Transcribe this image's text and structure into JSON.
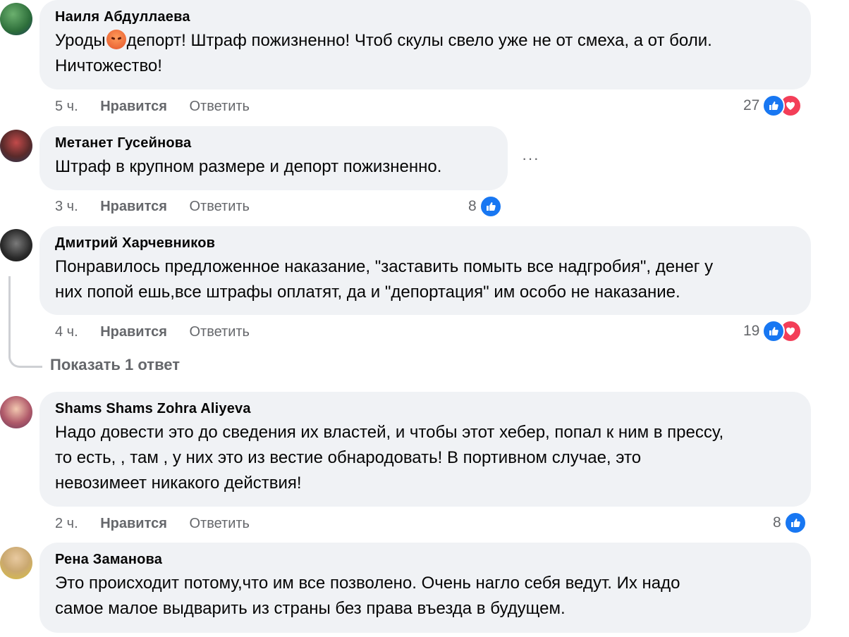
{
  "comments": [
    {
      "author": "Наиля Абдуллаева",
      "text_before_emoji": "Уроды",
      "emoji": "angry-face",
      "text_after_emoji": "депорт! Штраф пожизненно! Чтоб скулы свело уже не от смеха, а от боли.",
      "text_line2": "Ничтожество!",
      "time": "5 ч.",
      "like_label": "Нравится",
      "reply_label": "Ответить",
      "reaction_count": "27",
      "reactions": [
        "like",
        "love"
      ]
    },
    {
      "author": "Метанет Гусейнова",
      "text": "Штраф в крупном размере и депорт пожизненно.",
      "time": "3 ч.",
      "like_label": "Нравится",
      "reply_label": "Ответить",
      "reaction_count": "8",
      "reactions": [
        "like"
      ],
      "more_label": "···"
    },
    {
      "author": "Дмитрий Харчевников",
      "text": "Понравилось предложенное наказание, \"заставить помыть все надгробия\", денег у\nних попой ешь,все штрафы оплатят, да и \"депортация\" им особо не наказание.",
      "time": "4 ч.",
      "like_label": "Нравится",
      "reply_label": "Ответить",
      "reaction_count": "19",
      "reactions": [
        "like",
        "love"
      ],
      "show_replies_label": "Показать 1 ответ"
    },
    {
      "author": "Shams Shams Zohra Aliyeva",
      "text": "Надо довести это до сведения их властей, и чтобы этот хебер, попал к ним в прессу,\nто есть, , там , у них это из вестие обнародовать! В портивном случае, это\nневозимеет никакого действия!",
      "time": "2 ч.",
      "like_label": "Нравится",
      "reply_label": "Ответить",
      "reaction_count": "8",
      "reactions": [
        "like"
      ]
    },
    {
      "author": "Рена Заманова",
      "text": "Это происходит потому,что им все позволено. Очень нагло себя ведут. Их надо\nсамое малое выдварить из страны без права въезда в будущем."
    }
  ],
  "colors": {
    "bubble": "#f0f2f5",
    "secondary_text": "#65676b",
    "like_blue": "#1877f2",
    "love_red": "#f33e58"
  }
}
